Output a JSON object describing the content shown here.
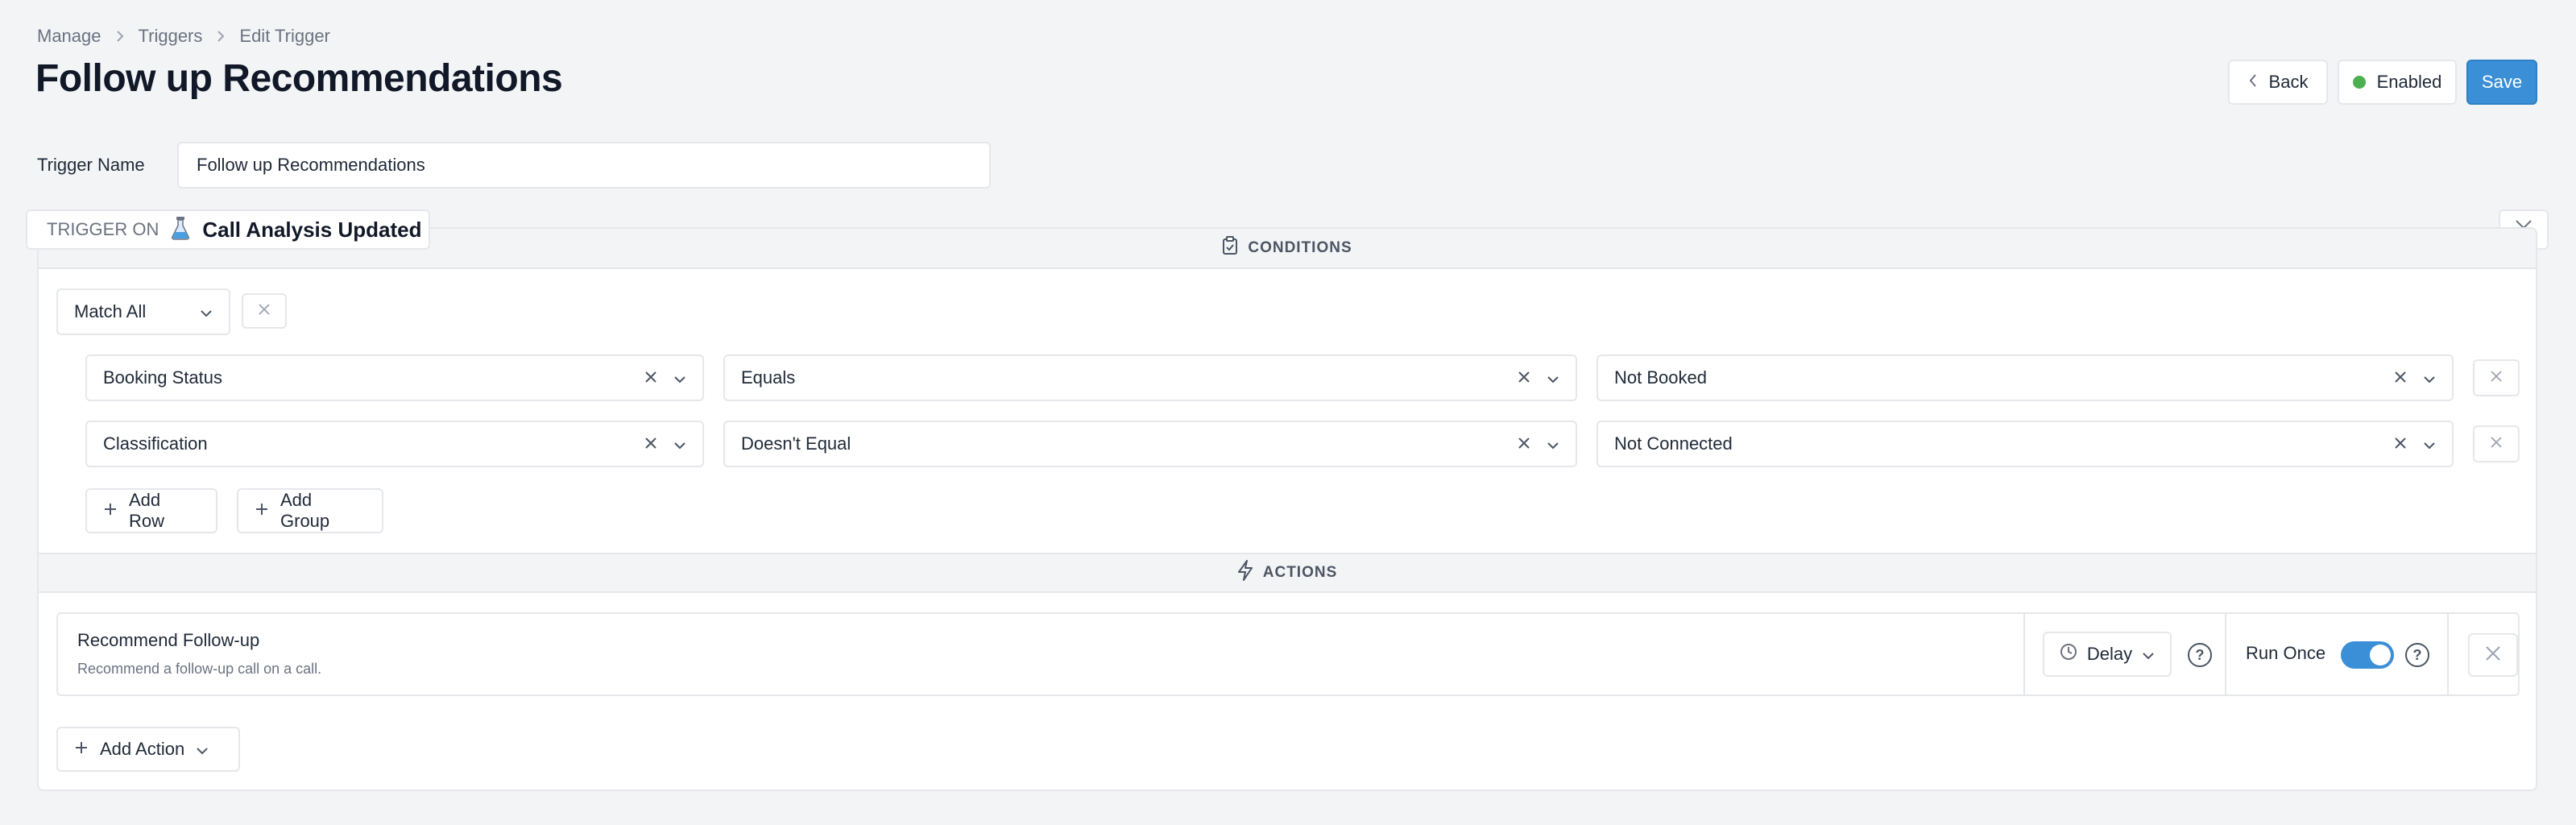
{
  "breadcrumb": [
    "Manage",
    "Triggers",
    "Edit Trigger"
  ],
  "page_title": "Follow up Recommendations",
  "header": {
    "back_label": "Back",
    "enabled_label": "Enabled",
    "save_label": "Save"
  },
  "trigger_name": {
    "label": "Trigger Name",
    "value": "Follow up Recommendations"
  },
  "trigger_on": {
    "label": "TRIGGER ON",
    "value": "Call Analysis Updated",
    "icon": "flask-icon"
  },
  "conditions": {
    "section_label": "CONDITIONS",
    "match_mode": "Match All",
    "rows": [
      {
        "field": "Booking Status",
        "operator": "Equals",
        "value": "Not Booked"
      },
      {
        "field": "Classification",
        "operator": "Doesn't Equal",
        "value": "Not Connected"
      }
    ],
    "add_row_label": "Add Row",
    "add_group_label": "Add Group"
  },
  "actions": {
    "section_label": "ACTIONS",
    "items": [
      {
        "title": "Recommend Follow-up",
        "description": "Recommend a follow-up call on a call.",
        "delay_label": "Delay",
        "run_once_label": "Run Once",
        "run_once_enabled": true
      }
    ],
    "add_action_label": "Add Action"
  },
  "colors": {
    "accent": "#3b8fd6",
    "enabled_dot": "#4caf50"
  }
}
